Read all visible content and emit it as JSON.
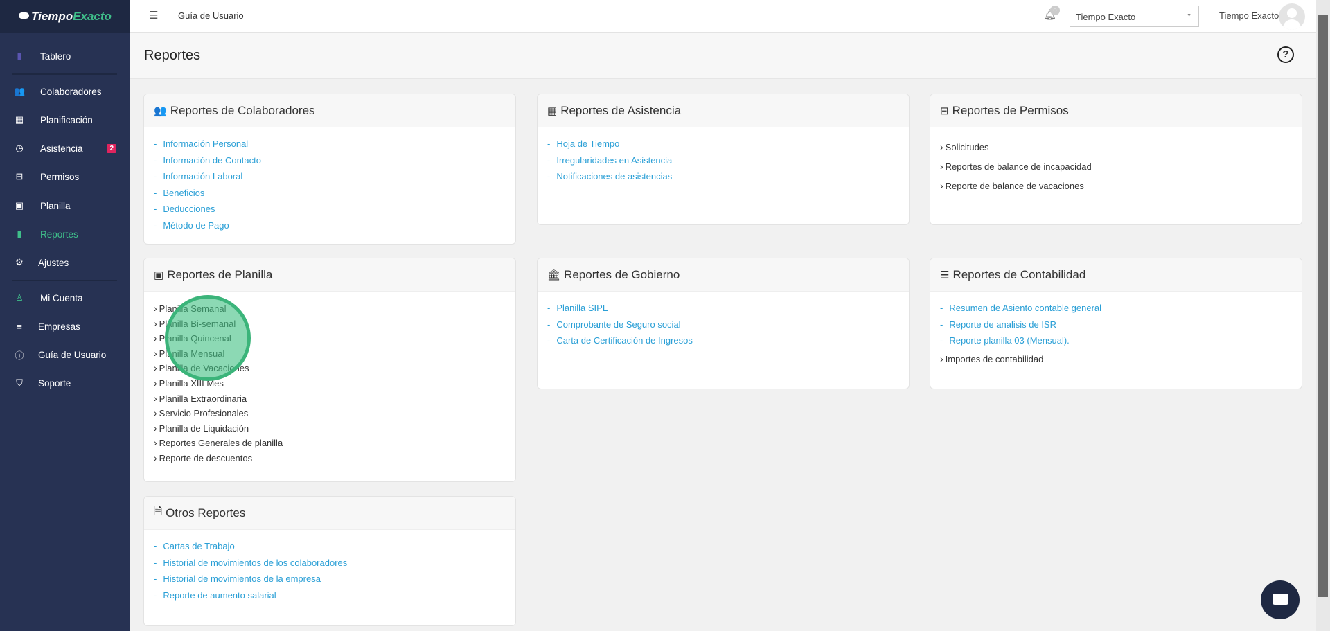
{
  "app": {
    "logo_a": "Tiempo",
    "logo_b": "Exacto"
  },
  "sidebar": {
    "items": [
      {
        "label": "Tablero",
        "icon": "bar-chart-icon"
      },
      {
        "label": "Colaboradores",
        "icon": "users-icon"
      },
      {
        "label": "Planificación",
        "icon": "calendar-icon"
      },
      {
        "label": "Asistencia",
        "icon": "clock-icon",
        "badge": "2"
      },
      {
        "label": "Permisos",
        "icon": "inbox-icon"
      },
      {
        "label": "Planilla",
        "icon": "money-icon"
      },
      {
        "label": "Reportes",
        "icon": "file-icon"
      },
      {
        "label": "Ajustes",
        "icon": "gear-icon"
      },
      {
        "label": "Mi Cuenta",
        "icon": "user-icon"
      },
      {
        "label": "Empresas",
        "icon": "sliders-icon"
      },
      {
        "label": "Guía de Usuario",
        "icon": "question-icon"
      },
      {
        "label": "Soporte",
        "icon": "shield-icon"
      }
    ]
  },
  "header": {
    "guide_link": "Guía de Usuario",
    "notifications": "0",
    "company_select": "Tiempo Exacto",
    "user_name": "Tiempo Exacto"
  },
  "page": {
    "title": "Reportes"
  },
  "cards": {
    "colaboradores": {
      "title": "Reportes de Colaboradores",
      "items": [
        "Información Personal",
        "Información de Contacto",
        "Información Laboral",
        "Beneficios",
        "Deducciones",
        "Método de Pago"
      ]
    },
    "asistencia": {
      "title": "Reportes de Asistencia",
      "items": [
        "Hoja de Tiempo",
        "Irregularidades en Asistencia",
        "Notificaciones de asistencias"
      ]
    },
    "permisos": {
      "title": "Reportes de Permisos",
      "items": [
        "Solicitudes",
        "Reportes de balance de incapacidad",
        "Reporte de balance de vacaciones"
      ]
    },
    "planilla": {
      "title": "Reportes de Planilla",
      "items": [
        "Planilla Semanal",
        "Planilla Bi-semanal",
        "Planilla Quincenal",
        "Planilla Mensual",
        "Planilla de Vacaciones",
        "Planilla XIII Mes",
        "Planilla Extraordinaria",
        "Servicio Profesionales",
        "Planilla de Liquidación",
        "Reportes Generales de planilla",
        "Reporte de descuentos"
      ]
    },
    "gobierno": {
      "title": "Reportes de Gobierno",
      "items": [
        "Planilla SIPE",
        "Comprobante de Seguro social",
        "Carta de Certificación de Ingresos"
      ]
    },
    "contabilidad": {
      "title": "Reportes de Contabilidad",
      "items": [
        "Resumen de Asiento contable general",
        "Reporte de analisis de ISR",
        "Reporte planilla 03 (Mensual).",
        "Importes de contabilidad"
      ]
    },
    "otros": {
      "title": "Otros Reportes",
      "items": [
        "Cartas de Trabajo",
        "Historial de movimientos de los colaboradores",
        "Historial de movimientos de la empresa",
        "Reporte de aumento salarial"
      ]
    }
  }
}
